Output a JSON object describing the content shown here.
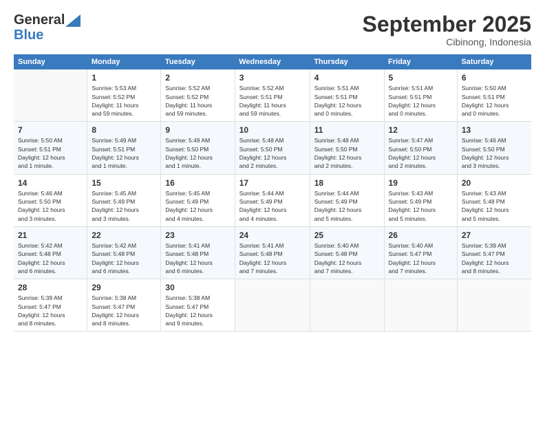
{
  "header": {
    "logo_line1": "General",
    "logo_line2": "Blue",
    "month": "September 2025",
    "location": "Cibinong, Indonesia"
  },
  "weekdays": [
    "Sunday",
    "Monday",
    "Tuesday",
    "Wednesday",
    "Thursday",
    "Friday",
    "Saturday"
  ],
  "weeks": [
    [
      {
        "num": "",
        "detail": ""
      },
      {
        "num": "1",
        "detail": "Sunrise: 5:53 AM\nSunset: 5:52 PM\nDaylight: 11 hours\nand 59 minutes."
      },
      {
        "num": "2",
        "detail": "Sunrise: 5:52 AM\nSunset: 5:52 PM\nDaylight: 11 hours\nand 59 minutes."
      },
      {
        "num": "3",
        "detail": "Sunrise: 5:52 AM\nSunset: 5:51 PM\nDaylight: 11 hours\nand 59 minutes."
      },
      {
        "num": "4",
        "detail": "Sunrise: 5:51 AM\nSunset: 5:51 PM\nDaylight: 12 hours\nand 0 minutes."
      },
      {
        "num": "5",
        "detail": "Sunrise: 5:51 AM\nSunset: 5:51 PM\nDaylight: 12 hours\nand 0 minutes."
      },
      {
        "num": "6",
        "detail": "Sunrise: 5:50 AM\nSunset: 5:51 PM\nDaylight: 12 hours\nand 0 minutes."
      }
    ],
    [
      {
        "num": "7",
        "detail": "Sunrise: 5:50 AM\nSunset: 5:51 PM\nDaylight: 12 hours\nand 1 minute."
      },
      {
        "num": "8",
        "detail": "Sunrise: 5:49 AM\nSunset: 5:51 PM\nDaylight: 12 hours\nand 1 minute."
      },
      {
        "num": "9",
        "detail": "Sunrise: 5:49 AM\nSunset: 5:50 PM\nDaylight: 12 hours\nand 1 minute."
      },
      {
        "num": "10",
        "detail": "Sunrise: 5:48 AM\nSunset: 5:50 PM\nDaylight: 12 hours\nand 2 minutes."
      },
      {
        "num": "11",
        "detail": "Sunrise: 5:48 AM\nSunset: 5:50 PM\nDaylight: 12 hours\nand 2 minutes."
      },
      {
        "num": "12",
        "detail": "Sunrise: 5:47 AM\nSunset: 5:50 PM\nDaylight: 12 hours\nand 2 minutes."
      },
      {
        "num": "13",
        "detail": "Sunrise: 5:46 AM\nSunset: 5:50 PM\nDaylight: 12 hours\nand 3 minutes."
      }
    ],
    [
      {
        "num": "14",
        "detail": "Sunrise: 5:46 AM\nSunset: 5:50 PM\nDaylight: 12 hours\nand 3 minutes."
      },
      {
        "num": "15",
        "detail": "Sunrise: 5:45 AM\nSunset: 5:49 PM\nDaylight: 12 hours\nand 3 minutes."
      },
      {
        "num": "16",
        "detail": "Sunrise: 5:45 AM\nSunset: 5:49 PM\nDaylight: 12 hours\nand 4 minutes."
      },
      {
        "num": "17",
        "detail": "Sunrise: 5:44 AM\nSunset: 5:49 PM\nDaylight: 12 hours\nand 4 minutes."
      },
      {
        "num": "18",
        "detail": "Sunrise: 5:44 AM\nSunset: 5:49 PM\nDaylight: 12 hours\nand 5 minutes."
      },
      {
        "num": "19",
        "detail": "Sunrise: 5:43 AM\nSunset: 5:49 PM\nDaylight: 12 hours\nand 5 minutes."
      },
      {
        "num": "20",
        "detail": "Sunrise: 5:43 AM\nSunset: 5:48 PM\nDaylight: 12 hours\nand 5 minutes."
      }
    ],
    [
      {
        "num": "21",
        "detail": "Sunrise: 5:42 AM\nSunset: 5:48 PM\nDaylight: 12 hours\nand 6 minutes."
      },
      {
        "num": "22",
        "detail": "Sunrise: 5:42 AM\nSunset: 5:48 PM\nDaylight: 12 hours\nand 6 minutes."
      },
      {
        "num": "23",
        "detail": "Sunrise: 5:41 AM\nSunset: 5:48 PM\nDaylight: 12 hours\nand 6 minutes."
      },
      {
        "num": "24",
        "detail": "Sunrise: 5:41 AM\nSunset: 5:48 PM\nDaylight: 12 hours\nand 7 minutes."
      },
      {
        "num": "25",
        "detail": "Sunrise: 5:40 AM\nSunset: 5:48 PM\nDaylight: 12 hours\nand 7 minutes."
      },
      {
        "num": "26",
        "detail": "Sunrise: 5:40 AM\nSunset: 5:47 PM\nDaylight: 12 hours\nand 7 minutes."
      },
      {
        "num": "27",
        "detail": "Sunrise: 5:39 AM\nSunset: 5:47 PM\nDaylight: 12 hours\nand 8 minutes."
      }
    ],
    [
      {
        "num": "28",
        "detail": "Sunrise: 5:39 AM\nSunset: 5:47 PM\nDaylight: 12 hours\nand 8 minutes."
      },
      {
        "num": "29",
        "detail": "Sunrise: 5:38 AM\nSunset: 5:47 PM\nDaylight: 12 hours\nand 8 minutes."
      },
      {
        "num": "30",
        "detail": "Sunrise: 5:38 AM\nSunset: 5:47 PM\nDaylight: 12 hours\nand 9 minutes."
      },
      {
        "num": "",
        "detail": ""
      },
      {
        "num": "",
        "detail": ""
      },
      {
        "num": "",
        "detail": ""
      },
      {
        "num": "",
        "detail": ""
      }
    ]
  ]
}
